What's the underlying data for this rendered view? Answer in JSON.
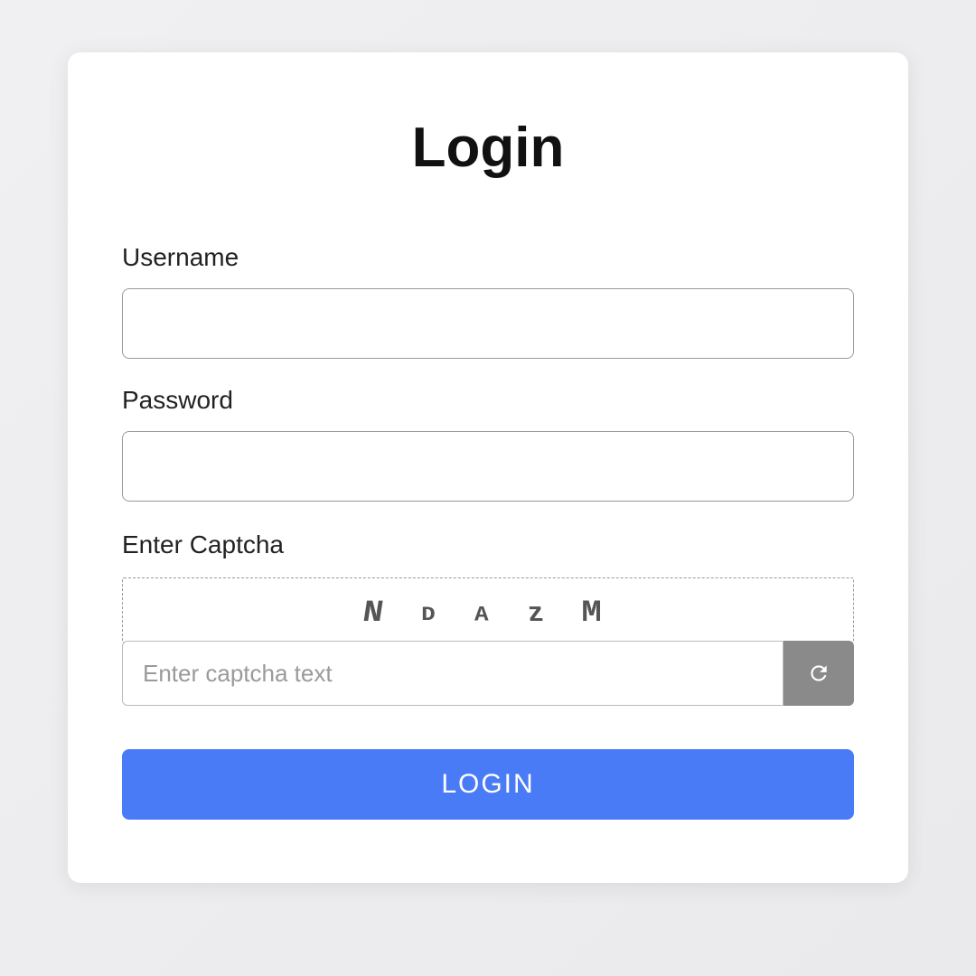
{
  "form": {
    "title": "Login",
    "username_label": "Username",
    "username_value": "",
    "password_label": "Password",
    "password_value": "",
    "captcha_label": "Enter Captcha",
    "captcha_chars": [
      "N",
      "D",
      "A",
      "z",
      "M"
    ],
    "captcha_placeholder": "Enter captcha text",
    "captcha_value": "",
    "login_button": "LOGIN"
  }
}
